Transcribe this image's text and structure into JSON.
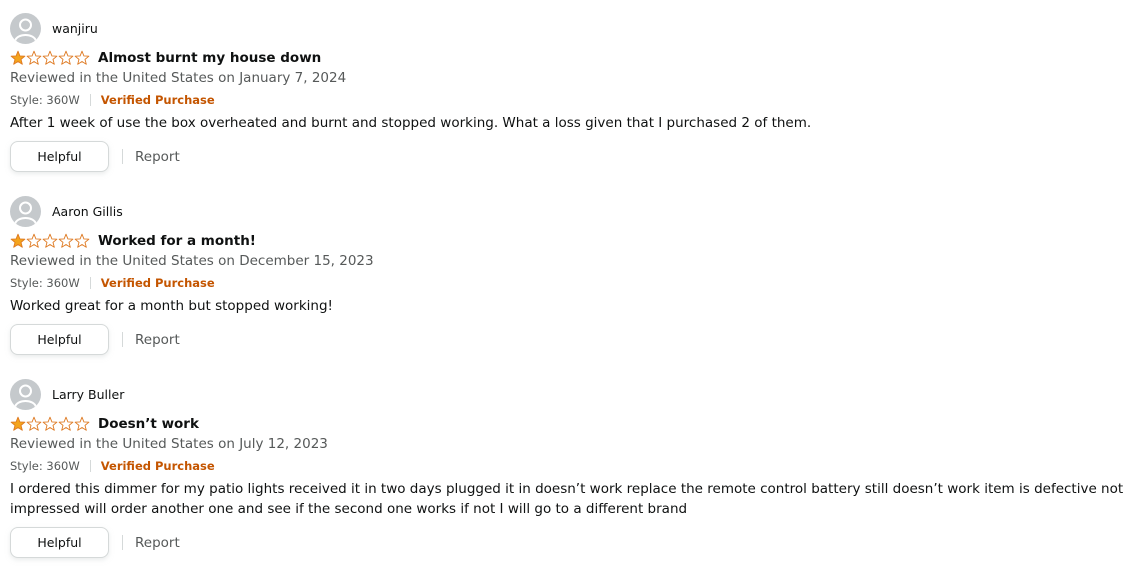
{
  "reviews": [
    {
      "author": "wanjiru",
      "rating": 1,
      "title": "Almost burnt my house down",
      "date": "Reviewed in the United States on January 7, 2024",
      "style": "Style: 360W",
      "verified": "Verified Purchase",
      "body": "After 1 week of use the box overheated and burnt and stopped working. What a loss given that I purchased 2 of them.",
      "helpful_label": "Helpful",
      "report_label": "Report"
    },
    {
      "author": "Aaron Gillis",
      "rating": 1,
      "title": "Worked for a month!",
      "date": "Reviewed in the United States on December 15, 2023",
      "style": "Style: 360W",
      "verified": "Verified Purchase",
      "body": "Worked great for a month but stopped working!",
      "helpful_label": "Helpful",
      "report_label": "Report"
    },
    {
      "author": "Larry Buller",
      "rating": 1,
      "title": "Doesn’t work",
      "date": "Reviewed in the United States on July 12, 2023",
      "style": "Style: 360W",
      "verified": "Verified Purchase",
      "body": "I ordered this dimmer for my patio lights received it in two days plugged it in doesn’t work replace the remote control battery still doesn’t work item is defective not impressed will order another one and see if the second one works if not I will go to a different brand",
      "helpful_label": "Helpful",
      "report_label": "Report"
    }
  ],
  "colors": {
    "star_filled": "#f4a41d",
    "star_outline": "#de7921",
    "verified": "#c45500",
    "muted_text": "#565959"
  },
  "icons": {
    "avatar": "default-avatar-icon",
    "star_full": "star-filled-icon",
    "star_empty": "star-empty-icon"
  }
}
